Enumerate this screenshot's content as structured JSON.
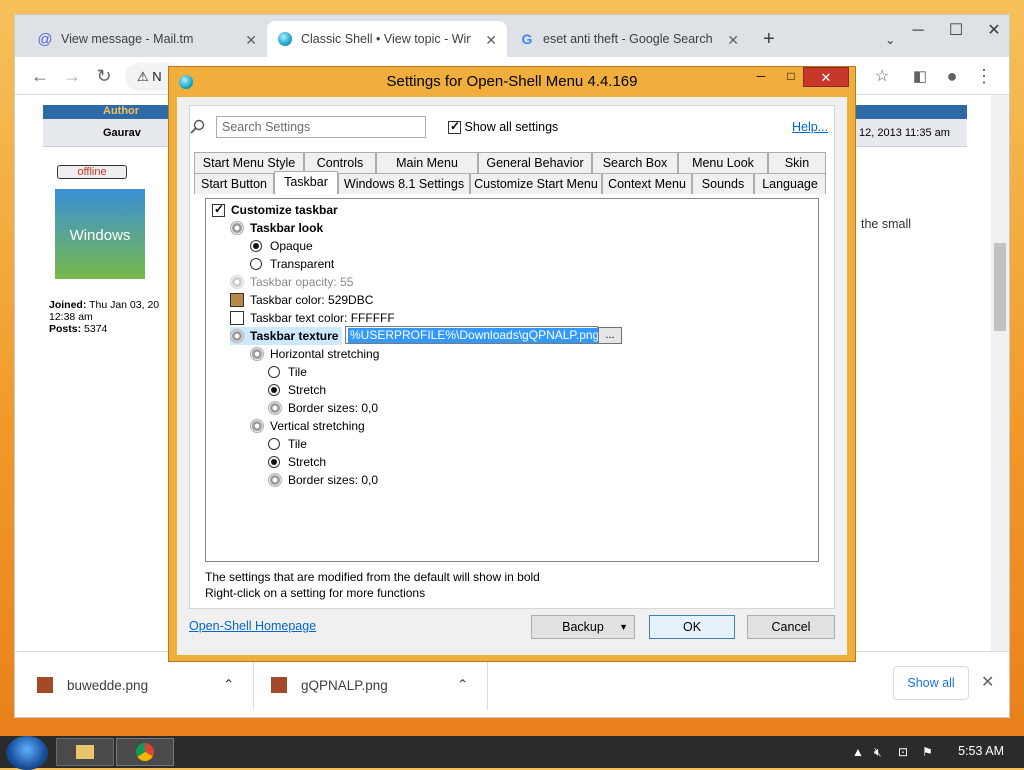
{
  "browser": {
    "tabs": [
      {
        "label": "View message - Mail.tm"
      },
      {
        "label": "Classic Shell • View topic - Windo"
      },
      {
        "label": "eset anti theft - Google Search"
      }
    ],
    "new_tab": "+",
    "address_text": "N",
    "window_controls": {
      "min": "─",
      "max": "☐",
      "close": "✕"
    }
  },
  "forum": {
    "author_header": "Author",
    "author_name": "Gaurav",
    "status": "offline",
    "avatar_text": "Windows",
    "joined_label": "Joined:",
    "joined_value": "Thu Jan 03, 20",
    "joined_time": "12:38 am",
    "posts_label": "Posts:",
    "posts_value": "5374",
    "post_date": "12, 2013 11:35 am",
    "body_snippet": "the small"
  },
  "downloads": {
    "items": [
      {
        "name": "buwedde.png"
      },
      {
        "name": "gQPNALP.png"
      }
    ],
    "show_all": "Show all"
  },
  "dialog": {
    "title": "Settings for Open-Shell Menu 4.4.169",
    "search_placeholder": "Search Settings",
    "show_all_settings": "Show all settings",
    "help": "Help...",
    "tabs_row1": [
      "Start Menu Style",
      "Controls",
      "Main Menu",
      "General Behavior",
      "Search Box",
      "Menu Look",
      "Skin"
    ],
    "tabs_row2": [
      "Start Button",
      "Taskbar",
      "Windows 8.1 Settings",
      "Customize Start Menu",
      "Context Menu",
      "Sounds",
      "Language"
    ],
    "selected_tab": "Taskbar",
    "tree": {
      "customize_taskbar": "Customize taskbar",
      "taskbar_look": "Taskbar look",
      "opaque": "Opaque",
      "transparent": "Transparent",
      "opacity": "Taskbar opacity: 55",
      "color": "Taskbar color: 529DBC",
      "text_color": "Taskbar text color: FFFFFF",
      "texture": "Taskbar texture",
      "texture_value": "%USERPROFILE%\\Downloads\\gQPNALP.png",
      "browse": "...",
      "h_stretch": "Horizontal stretching",
      "h_tile": "Tile",
      "h_stretch_opt": "Stretch",
      "h_border": "Border sizes: 0,0",
      "v_stretch": "Vertical stretching",
      "v_tile": "Tile",
      "v_stretch_opt": "Stretch",
      "v_border": "Border sizes: 0,0"
    },
    "footnote1": "The settings that are modified from the default will show in bold",
    "footnote2": "Right-click on a setting for more functions",
    "homepage": "Open-Shell Homepage",
    "backup": "Backup",
    "ok": "OK",
    "cancel": "Cancel"
  },
  "taskbar": {
    "time": "5:53 AM"
  },
  "colors": {
    "taskbar_color_swatch": "#B48A4C",
    "dialog_frame": "#f0ae3c"
  }
}
